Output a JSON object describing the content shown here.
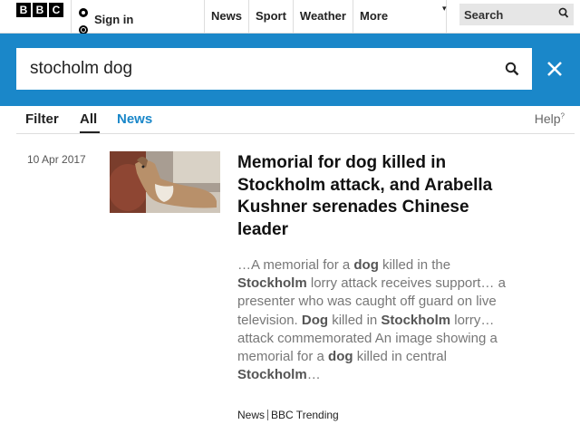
{
  "header": {
    "logo_letters": [
      "B",
      "B",
      "C"
    ],
    "sign_in_label": "Sign in",
    "nav": [
      {
        "label": "News"
      },
      {
        "label": "Sport"
      },
      {
        "label": "Weather"
      },
      {
        "label": "More"
      }
    ],
    "search_label": "Search"
  },
  "search": {
    "query": "stocholm dog"
  },
  "filters": {
    "filter_label": "Filter",
    "tabs": [
      {
        "label": "All",
        "selected": true
      },
      {
        "label": "News",
        "selected": false
      }
    ],
    "help_label": "Help",
    "help_mark": "?"
  },
  "result": {
    "date": "10 Apr 2017",
    "headline": "Memorial for dog killed in Stockholm attack, and Arabella Kushner serenades Chinese leader",
    "snippet": [
      {
        "t": "…A memorial for a ",
        "b": false
      },
      {
        "t": "dog",
        "b": true
      },
      {
        "t": " killed in the ",
        "b": false
      },
      {
        "t": "Stockholm",
        "b": true
      },
      {
        "t": " lorry attack receives support… a presenter who was caught off guard on live television. ",
        "b": false
      },
      {
        "t": "Dog",
        "b": true
      },
      {
        "t": " killed in ",
        "b": false
      },
      {
        "t": "Stockholm",
        "b": true
      },
      {
        "t": " lorry… attack commemorated An image showing a memorial for a ",
        "b": false
      },
      {
        "t": "dog",
        "b": true
      },
      {
        "t": " killed in central ",
        "b": false
      },
      {
        "t": "Stockholm",
        "b": true
      },
      {
        "t": "…",
        "b": false
      }
    ],
    "section": "News",
    "subsection": "BBC Trending"
  },
  "colors": {
    "accent": "#1a87c9",
    "logo_bg": "#000000"
  }
}
